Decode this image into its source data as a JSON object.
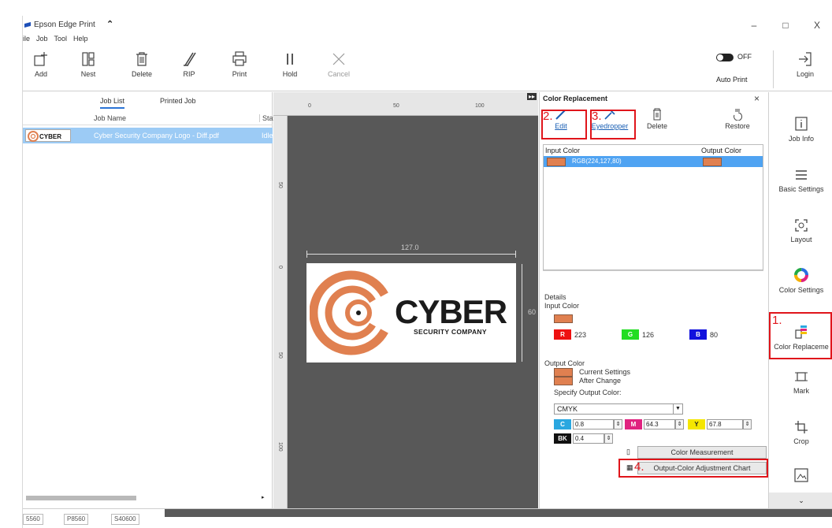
{
  "window": {
    "title": "Epson Edge Print",
    "minimize": "–",
    "maximize": "□",
    "close": "X"
  },
  "menu": [
    "ile",
    "Job",
    "Tool",
    "Help"
  ],
  "toolbar": {
    "add": "Add",
    "nest": "Nest",
    "delete": "Delete",
    "rip": "RIP",
    "print": "Print",
    "hold": "Hold",
    "cancel": "Cancel",
    "toggle_state": "OFF",
    "auto_print": "Auto Print",
    "login": "Login"
  },
  "job_list": {
    "tabs": [
      "Job List",
      "Printed Job"
    ],
    "columns": [
      "Job Name",
      "Stat"
    ],
    "rows": [
      {
        "thumb": "CYBER",
        "name": "Cyber Security Company Logo - Diff.pdf",
        "status": "Idle"
      }
    ]
  },
  "canvas": {
    "ruler_top": [
      "0",
      "50",
      "100"
    ],
    "ruler_left": [
      "50",
      "0",
      "50",
      "100"
    ],
    "width_label": "127.0",
    "height_label": "60",
    "logo_word": "CYBER",
    "logo_sub": "SECURITY COMPANY"
  },
  "color_replacement": {
    "title": "Color Replacement",
    "close": "×",
    "tools": {
      "edit": "Edit",
      "eyedropper": "Eyedropper",
      "delete": "Delete",
      "restore": "Restore"
    },
    "table_headers": {
      "input": "Input Color",
      "output": "Output Color"
    },
    "rows": [
      {
        "input": "RGB(224,127,80)"
      }
    ],
    "swatch_color": "#e08050",
    "details": {
      "label": "Details",
      "input_color_label": "Input Color",
      "r_label": "R",
      "r": "223",
      "g_label": "G",
      "g": "126",
      "b_label": "B",
      "b": "80",
      "output_color_label": "Output Color",
      "current_settings": "Current Settings",
      "after_change": "After Change",
      "specify_label": "Specify Output Color:",
      "mode": "CMYK",
      "c_label": "C",
      "c": "0.8",
      "m_label": "M",
      "m": "64.3",
      "y_label": "Y",
      "y": "67.8",
      "bk_label": "BK",
      "bk": "0.4",
      "color_measurement": "Color Measurement",
      "adjust_chart": "Output-Color Adjustment Chart"
    },
    "annotations": {
      "n1": "1.",
      "n2": "2.",
      "n3": "3.",
      "n4": "4."
    }
  },
  "sidebar": {
    "items": [
      "Job Info",
      "Basic Settings",
      "Layout",
      "Color Settings",
      "Color Replaceme",
      "Mark",
      "Crop"
    ],
    "scroll_down": "⌄"
  },
  "status": {
    "items": [
      "5560",
      "P8560",
      "S40600"
    ]
  },
  "colors": {
    "accent": "#2b74d6",
    "selection": "#4fa3f2",
    "annotation": "#e0151b",
    "channel_r": "#ee1111",
    "channel_g": "#22dd22",
    "channel_b": "#1111dd",
    "channel_c": "#2aa7e0",
    "channel_m": "#e0237f",
    "channel_y": "#f5e600",
    "channel_k": "#111111"
  }
}
